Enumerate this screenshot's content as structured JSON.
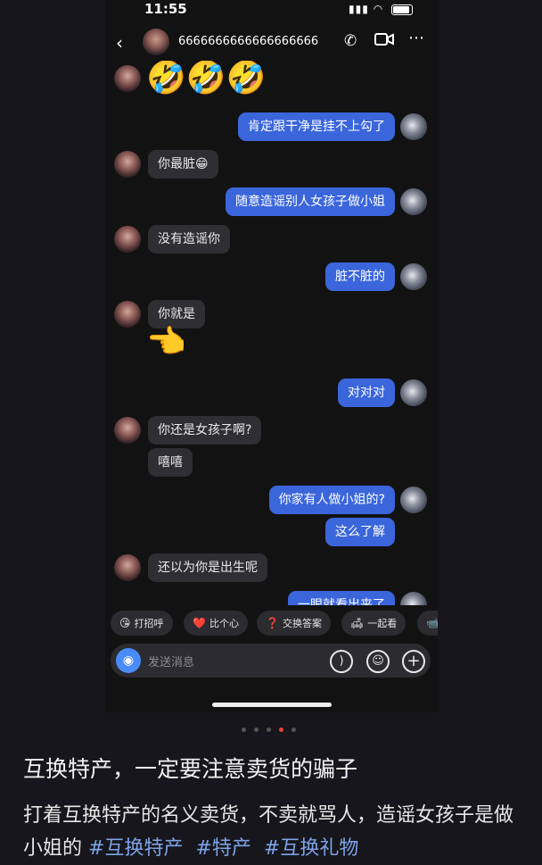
{
  "status": {
    "time": "11:55"
  },
  "header": {
    "name": "6666666666666666666"
  },
  "messages": [
    {
      "side": "o",
      "type": "emoji",
      "text": "🤣🤣🤣"
    },
    {
      "side": "m",
      "type": "text",
      "text": "肯定跟干净是挂不上勾了"
    },
    {
      "side": "o",
      "type": "text",
      "text": "你最脏😁"
    },
    {
      "side": "m",
      "type": "text",
      "text": "随意造谣别人女孩子做小姐"
    },
    {
      "side": "o",
      "type": "text",
      "text": "没有造谣你"
    },
    {
      "side": "m",
      "type": "text",
      "text": "脏不脏的"
    },
    {
      "side": "o",
      "type": "text",
      "text": "你就是"
    },
    {
      "side": "o",
      "type": "emoji",
      "text": "👈"
    },
    {
      "side": "m",
      "type": "text",
      "text": "对对对"
    },
    {
      "side": "o",
      "type": "text",
      "text": "你还是女孩子啊?"
    },
    {
      "side": "o",
      "type": "text",
      "text": "嘻嘻"
    },
    {
      "side": "m",
      "type": "text",
      "text": "你家有人做小姐的?"
    },
    {
      "side": "m",
      "type": "text",
      "text": "这么了解"
    },
    {
      "side": "o",
      "type": "text",
      "text": "还以为你是出生呢"
    },
    {
      "side": "m",
      "type": "text",
      "text": "一眼就看出来了"
    }
  ],
  "quick_actions": [
    {
      "icon": "😘",
      "label": "打招呼"
    },
    {
      "icon": "❤️",
      "label": "比个心"
    },
    {
      "icon": "❓",
      "label": "交换答案"
    },
    {
      "icon": "🛋",
      "label": "一起看"
    },
    {
      "icon": "📹",
      "label": ""
    }
  ],
  "input": {
    "placeholder": "发送消息"
  },
  "caption": {
    "title": "互换特产，一定要注意卖货的骗子",
    "body": "打着互换特产的名义卖货，不卖就骂人，造谣女孩子是做小姐的",
    "tags": [
      "#互换特产",
      "#特产",
      "#互换礼物"
    ]
  },
  "pager": {
    "count": 5,
    "active": 3
  },
  "colors": {
    "my_bubble": "#3b66db",
    "other_bubble": "#2e2e33",
    "accent": "#4a8cf7",
    "tag": "#7ea3e8",
    "active_dot": "#e8403a"
  }
}
